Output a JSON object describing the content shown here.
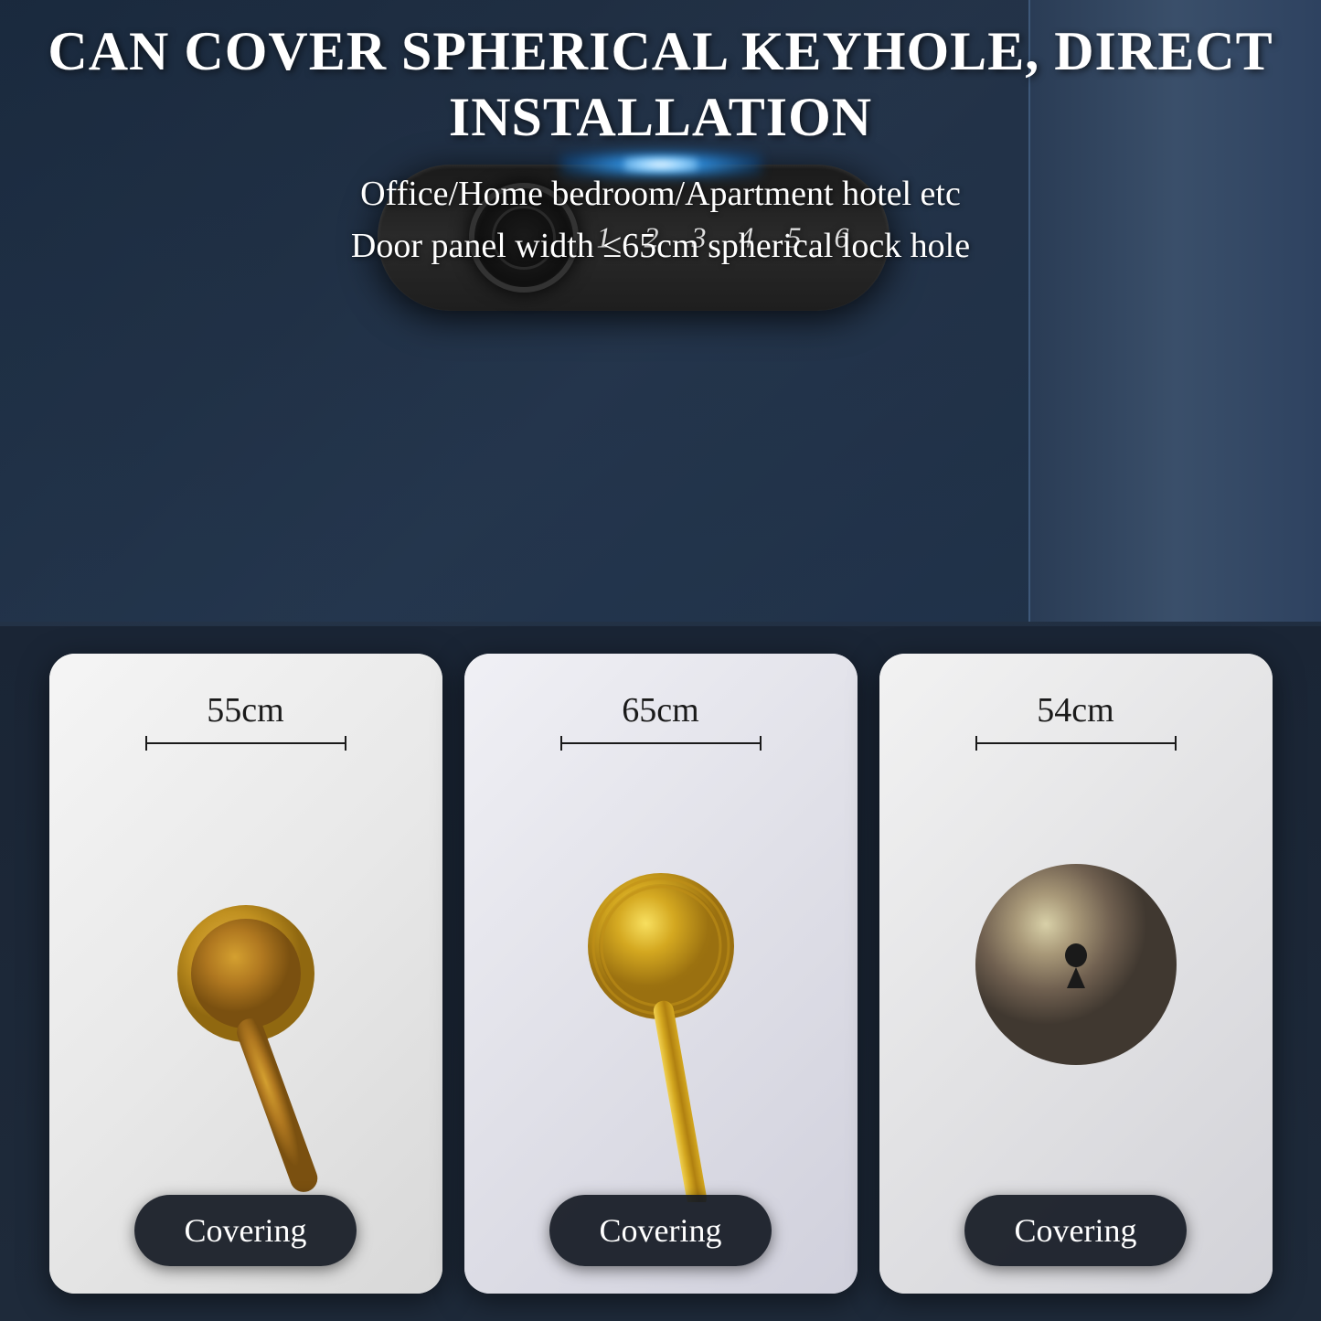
{
  "headline": "CAN COVER SPHERICAL KEYHOLE, DIRECT INSTALLATION",
  "subtext_line1": "Office/Home bedroom/Apartment hotel etc",
  "subtext_line2": "Door panel width ≤65cm spherical lock hole",
  "lock": {
    "numbers": [
      "1",
      "2",
      "3",
      "4",
      "5",
      "6"
    ]
  },
  "cards": [
    {
      "id": "card-1",
      "measurement": "55cm",
      "label": "Covering"
    },
    {
      "id": "card-2",
      "measurement": "65cm",
      "label": "Covering"
    },
    {
      "id": "card-3",
      "measurement": "54cm",
      "label": "Covering"
    }
  ]
}
